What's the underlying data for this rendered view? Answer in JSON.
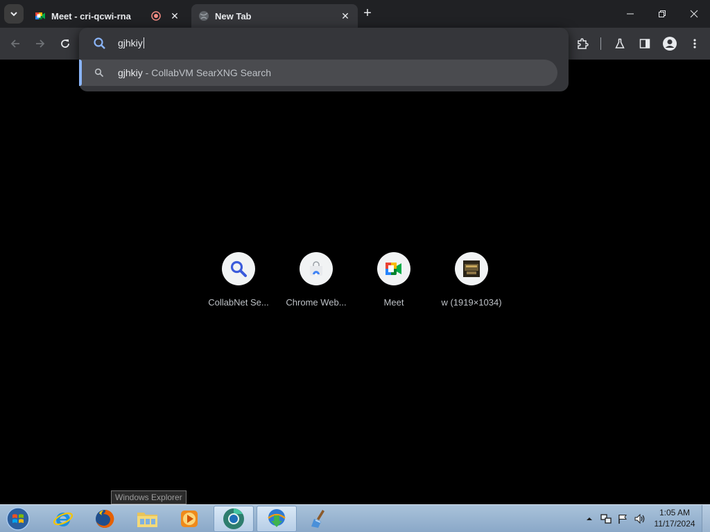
{
  "browser": {
    "tabs": [
      {
        "title": "Meet - cri-qcwi-rna",
        "icon": "google-meet-icon",
        "recording": true,
        "active": false
      },
      {
        "title": "New Tab",
        "icon": "globe-icon",
        "active": true
      }
    ],
    "new_tab_symbol": "+",
    "close_symbol": "✕"
  },
  "omnibox": {
    "query": "gjhkiy",
    "suggestion": {
      "query": "gjhkiy",
      "separator": " - ",
      "source": "CollabVM SearXNG Search"
    }
  },
  "shortcuts": [
    {
      "label": "CollabNet Se...",
      "icon": "search-icon"
    },
    {
      "label": "Chrome Web...",
      "icon": "chrome-web-store-icon"
    },
    {
      "label": "Meet",
      "icon": "google-meet-icon"
    },
    {
      "label": "w (1919×1034)",
      "icon": "image-thumbnail-icon"
    }
  ],
  "tooltip": "Windows Explorer",
  "taskbar": {
    "items": [
      {
        "name": "internet-explorer-icon"
      },
      {
        "name": "firefox-icon"
      },
      {
        "name": "windows-explorer-icon"
      },
      {
        "name": "windows-media-player-icon"
      },
      {
        "name": "chrome-icon",
        "active": true
      },
      {
        "name": "internet-download-manager-icon",
        "active": true
      },
      {
        "name": "ccleaner-icon"
      }
    ],
    "clock": {
      "time": "1:05 AM",
      "date": "11/17/2024"
    }
  },
  "colors": {
    "tabstrip": "#202124",
    "toolbar": "#35363a",
    "accent": "#8ab4f8",
    "page_background": "#000000"
  }
}
